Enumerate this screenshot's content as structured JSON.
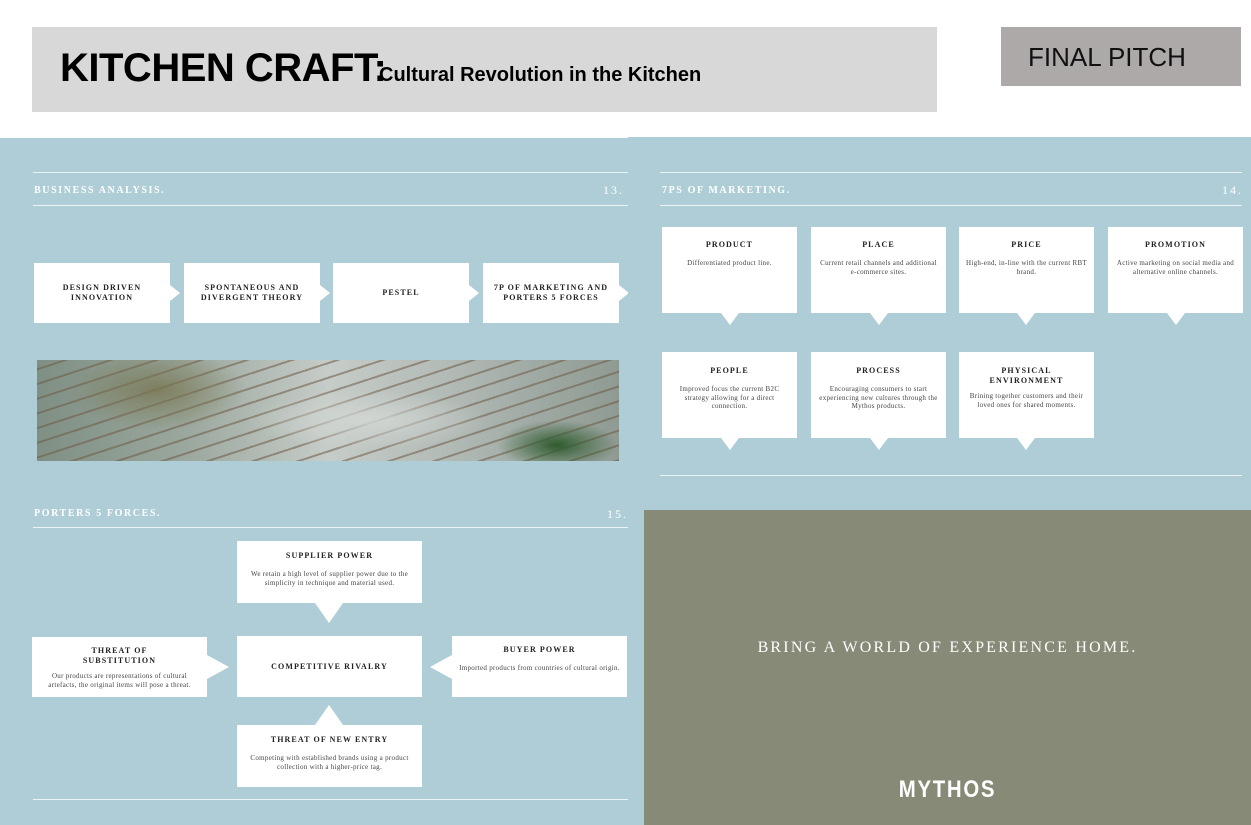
{
  "header": {
    "title": "KITCHEN CRAFT:",
    "subtitle": "Cultural Revolution in the Kitchen",
    "badge": "FINAL PITCH"
  },
  "business_analysis": {
    "title": "BUSINESS ANALYSIS.",
    "page_number": "13.",
    "steps": [
      "DESIGN DRIVEN INNOVATION",
      "SPONTANEOUS AND DIVERGENT THEORY",
      "PESTEL",
      "7P OF MARKETING AND PORTERS 5 FORCES"
    ]
  },
  "marketing": {
    "title": "7PS OF MARKETING.",
    "page_number": "14.",
    "items": [
      {
        "title": "PRODUCT",
        "text": "Differentiated product line."
      },
      {
        "title": "PLACE",
        "text": "Current retail channels and additional e-commerce sites."
      },
      {
        "title": "PRICE",
        "text": "High-end, in-line with the current RBT brand."
      },
      {
        "title": "PROMOTION",
        "text": "Active marketing on social media and alternative online channels."
      },
      {
        "title": "PEOPLE",
        "text": "Improved focus the current B2C strategy allowing for a direct connection."
      },
      {
        "title": "PROCESS",
        "text": "Encouraging consumers to start experiencing new cultures through the Mythos products."
      },
      {
        "title": "PHYSICAL ENVIRONMENT",
        "text": "Brining together customers and their loved ones for shared moments."
      }
    ]
  },
  "porters": {
    "title": "PORTERS 5 FORCES.",
    "page_number": "15.",
    "supplier": {
      "title": "SUPPLIER POWER",
      "text": "We retain a high level of supplier power due to the simplicity in technique and material used."
    },
    "substitution": {
      "title": "THREAT OF SUBSTITUTION",
      "text": "Our products are representations of cultural artefacts, the original items will pose a threat."
    },
    "rivalry": {
      "title": "COMPETITIVE RIVALRY"
    },
    "buyer": {
      "title": "BUYER POWER",
      "text": "Imported products from countries of cultural origin."
    },
    "new_entry": {
      "title": "THREAT OF NEW ENTRY",
      "text": "Competing with established brands using a product collection with a higher-price tag."
    }
  },
  "brand_slide": {
    "tagline": "BRING A WORLD OF EXPERIENCE HOME.",
    "brand": "MYTHOS"
  }
}
